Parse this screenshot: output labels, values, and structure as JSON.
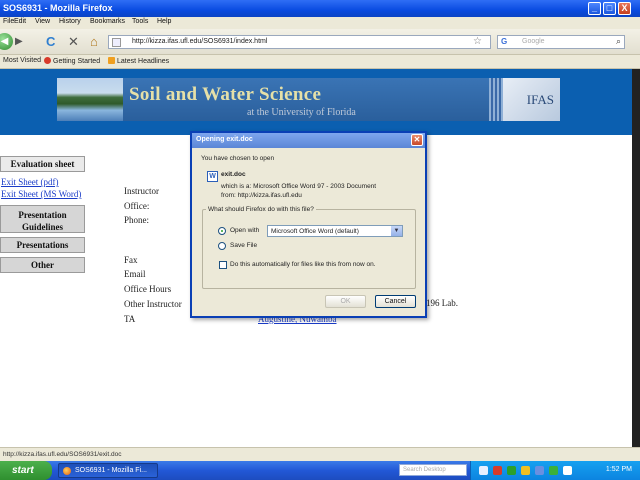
{
  "window": {
    "title": "SOS6931 - Mozilla Firefox",
    "minimize": "_",
    "maximize": "□",
    "close": "X"
  },
  "menu": [
    "File",
    "Edit",
    "View",
    "History",
    "Bookmarks",
    "Tools",
    "Help"
  ],
  "nav": {
    "back": "◀",
    "forward": "▶",
    "reload": "C",
    "stop": "✕",
    "home": "⌂",
    "url": "http://kizza.ifas.ufl.edu/SOS6931/index.html",
    "star": "☆",
    "search_engine": "G",
    "search_placeholder": "Google",
    "search_icon": "⌕"
  },
  "bookmarks": [
    "Most Visited",
    "Getting Started",
    "Latest Headlines"
  ],
  "banner": {
    "title": "Soil and Water Science",
    "subtitle": "at the University of Florida",
    "logo": "IFAS"
  },
  "sidebar": {
    "evaluation": "Evaluation sheet",
    "exit_pdf": "Exit Sheet (pdf)",
    "exit_word": "Exit Sheet (MS Word)",
    "presentation_guidelines": "Presentation Guidelines",
    "presentations": "Presentations",
    "other": "Other"
  },
  "info": {
    "instructor": "Instructor",
    "office": "Office:",
    "phone": "Phone:",
    "fax": "Fax",
    "email": "Email",
    "office_hours": "Office Hours",
    "other_instructor": "Other Instructor",
    "ta": "TA",
    "ta_name": "Augustine, Nuwamba",
    "lab_fragment": "196 Lab."
  },
  "dialog": {
    "title": "Opening exit.doc",
    "intro": "You have chosen to open",
    "filename": "exit.doc",
    "which_is": "which is a:  Microsoft Office Word 97 - 2003 Document",
    "from": "from: http://kizza.ifas.ufl.edu",
    "question": "What should Firefox do with this file?",
    "open_with": "Open with",
    "open_with_app": "Microsoft Office Word (default)",
    "save_file": "Save File",
    "auto": "Do this automatically for files like this from now on.",
    "ok": "OK",
    "cancel": "Cancel"
  },
  "status": {
    "text": "http://kizza.ifas.ufl.edu/SOS6931/exit.doc"
  },
  "taskbar": {
    "start": "start",
    "item": "SOS6931 - Mozilla Fi...",
    "search": "Search Desktop",
    "clock": "1:52 PM"
  }
}
